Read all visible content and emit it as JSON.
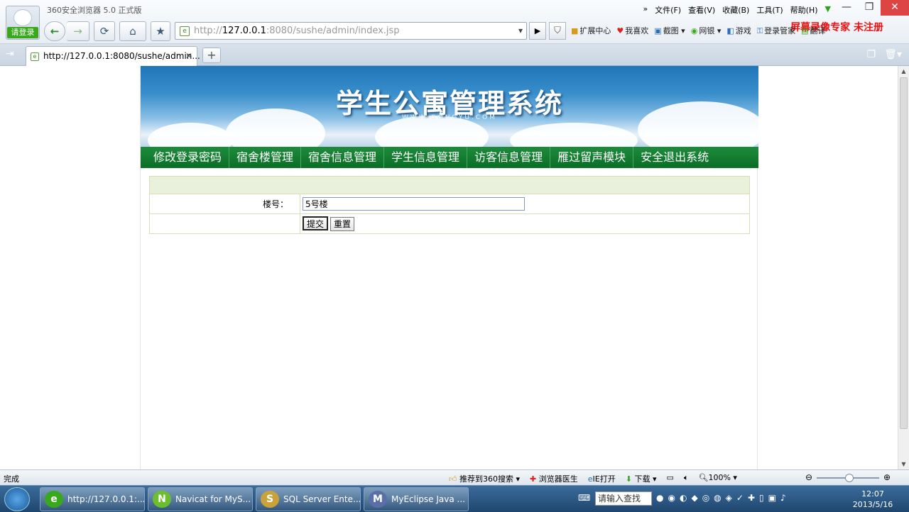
{
  "browser": {
    "login_label": "请登录",
    "app_title": "360安全浏览器 5.0 正式版",
    "menu": [
      "文件(F)",
      "查看(V)",
      "收藏(B)",
      "工具(T)",
      "帮助(H)"
    ],
    "menu_chevron": "»",
    "watermark": "屏幕录像专家 未注册",
    "address": {
      "prefix": "http://",
      "host": "127.0.0.1",
      "rest": ":8080/sushe/admin/index.jsp"
    },
    "toolbar": [
      "扩展中心",
      "我喜欢",
      "截图",
      "网银",
      "游戏",
      "登录管家",
      "翻译"
    ],
    "tab": {
      "label": "http://127.0.0.1:8080/sushe/admin..."
    }
  },
  "page": {
    "banner_title": "学生公寓管理系统",
    "banner_sub": "WWW.GONGYU.COM",
    "nav": [
      "修改登录密码",
      "宿舍楼管理",
      "宿舍信息管理",
      "学生信息管理",
      "访客信息管理",
      "雁过留声模块",
      "安全退出系统"
    ],
    "form": {
      "label": "楼号：",
      "value": "5号楼",
      "submit": "提交",
      "reset": "重置"
    }
  },
  "statusbar": {
    "status": "完成",
    "items": [
      "推荐到360搜索",
      "浏览器医生",
      "IE打开",
      "下载"
    ],
    "zoom": "100%"
  },
  "taskbar": {
    "tasks": [
      {
        "label": "http://127.0.0.1:...",
        "color": "#3aa81c"
      },
      {
        "label": "Navicat for MyS...",
        "color": "#6bbf2f"
      },
      {
        "label": "SQL Server Ente...",
        "color": "#c9a23a"
      },
      {
        "label": "MyEclipse Java ...",
        "color": "#5a6fa8"
      }
    ],
    "task_icon_glyphs": [
      "e",
      "N",
      "S",
      "M"
    ],
    "search_placeholder": "请输入查找",
    "time": "12:07",
    "date": "2013/5/16"
  }
}
